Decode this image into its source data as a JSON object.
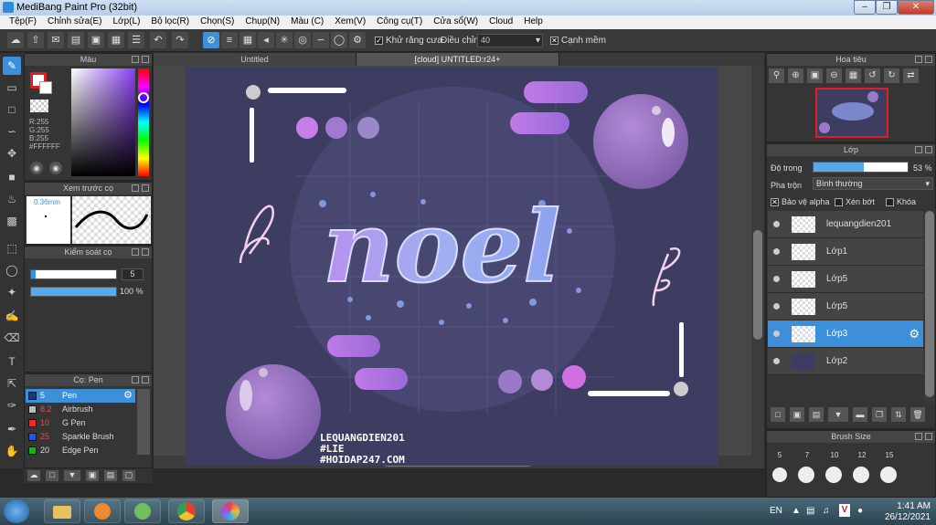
{
  "window": {
    "title": "MediBang Paint Pro (32bit)"
  },
  "menu": [
    "Tệp(F)",
    "Chỉnh sửa(E)",
    "Lớp(L)",
    "Bộ lọc(R)",
    "Chọn(S)",
    "Chụp(N)",
    "Màu (C)",
    "Xem(V)",
    "Công cụ(T)",
    "Cửa sổ(W)",
    "Cloud",
    "Help"
  ],
  "toolbar": {
    "antialias_label": "Khử răng cưa",
    "adjust_label": "Điều chỉnh",
    "adjust_value": "40",
    "sharp_label": "Cạnh mềm"
  },
  "color_panel": {
    "title": "Màu",
    "r": "R:255",
    "g": "G:255",
    "b": "B:255",
    "hex": "#FFFFFF"
  },
  "brush_preview": {
    "title": "Xem trước cọ",
    "size": "0.36mm"
  },
  "brush_control": {
    "title": "Kiểm soát cọ",
    "size": "5",
    "opacity": "100 %"
  },
  "brushes": {
    "title": "Cọ: Pen",
    "items": [
      {
        "size": "5",
        "name": "Pen",
        "color": "#3c8fd8"
      },
      {
        "size": "8.2",
        "name": "Airbrush",
        "color": "#bbbbbb"
      },
      {
        "size": "10",
        "name": "G Pen",
        "color": "#e03030"
      },
      {
        "size": "25",
        "name": "Sparkle Brush",
        "color": "#2255dd"
      },
      {
        "size": "20",
        "name": "Edge Pen",
        "color": "#22aa22"
      }
    ]
  },
  "tabs": [
    "Untitled",
    "[cloud] UNTITLED:r24+"
  ],
  "artwork": {
    "word": "noel",
    "signature": [
      "LEQUANGDIEN201",
      "#LIE",
      "#HOIDAP247.COM"
    ]
  },
  "navigator": {
    "title": "Hoa tiêu"
  },
  "layer_panel": {
    "title": "Lớp",
    "opacity_label": "Độ trong",
    "opacity_value": "53 %",
    "opacity_fraction": 0.53,
    "blend_label": "Pha trộn",
    "blend_value": "Bình thường",
    "protect_alpha": "Bảo vệ alpha",
    "clip": "Xén bớt",
    "lock": "Khóa",
    "layers": [
      "lequangdien201",
      "Lớp1",
      "Lớp5",
      "Lớp5",
      "Lớp3",
      "Lớp2"
    ],
    "selected_index": 4
  },
  "brush_size": {
    "title": "Brush Size",
    "sizes": [
      "5",
      "7",
      "10",
      "12",
      "15"
    ]
  },
  "taskbar": {
    "lang": "EN",
    "time": "1:41 AM",
    "date": "26/12/2021"
  }
}
